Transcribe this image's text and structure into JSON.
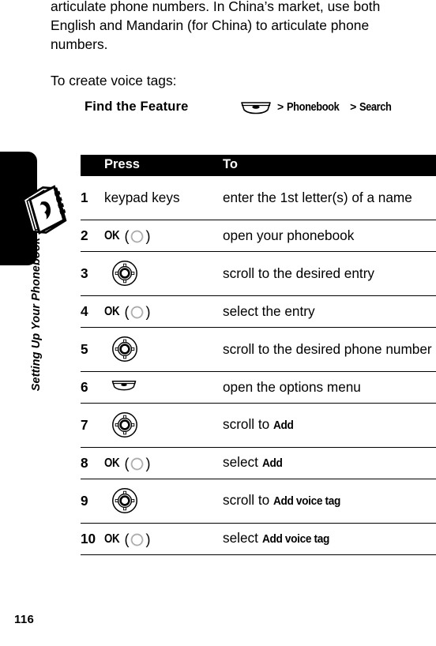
{
  "sidebar": {
    "chapter_title": "Setting Up Your Phonebook",
    "icon": "phonebook-icon"
  },
  "page": {
    "number": "116"
  },
  "intro": {
    "paragraph_1": "articulate phone numbers. In China’s market, use both English and Mandarin (for China) to articulate phone numbers.",
    "paragraph_2": "To create voice tags:"
  },
  "find_the_feature": {
    "label": "Find the Feature",
    "key_icon": "menu-key-icon",
    "path": [
      {
        "separator": ">",
        "item": "Phonebook"
      },
      {
        "separator": ">",
        "item": "Search"
      }
    ]
  },
  "steps_table": {
    "headers": {
      "number": "",
      "press": "Press",
      "to": "To"
    },
    "rows": [
      {
        "number": "1",
        "press_kind": "text",
        "press_text": "keypad keys",
        "to_prefix": "enter the 1st letter(s) of a name",
        "to_bold": ""
      },
      {
        "number": "2",
        "press_kind": "ok",
        "press_text": "OK",
        "to_prefix": "open your phonebook",
        "to_bold": ""
      },
      {
        "number": "3",
        "press_kind": "wheel",
        "press_text": "",
        "to_prefix": "scroll to the desired entry",
        "to_bold": ""
      },
      {
        "number": "4",
        "press_kind": "ok",
        "press_text": "OK",
        "to_prefix": "select the entry",
        "to_bold": ""
      },
      {
        "number": "5",
        "press_kind": "wheel",
        "press_text": "",
        "to_prefix": "scroll to the desired phone number",
        "to_bold": ""
      },
      {
        "number": "6",
        "press_kind": "menu",
        "press_text": "",
        "to_prefix": "open the options menu",
        "to_bold": ""
      },
      {
        "number": "7",
        "press_kind": "wheel",
        "press_text": "",
        "to_prefix": "scroll to ",
        "to_bold": "Add"
      },
      {
        "number": "8",
        "press_kind": "ok",
        "press_text": "OK",
        "to_prefix": "select ",
        "to_bold": "Add"
      },
      {
        "number": "9",
        "press_kind": "wheel",
        "press_text": "",
        "to_prefix": "scroll to ",
        "to_bold": "Add voice tag"
      },
      {
        "number": "10",
        "press_kind": "ok",
        "press_text": "OK",
        "to_prefix": "select ",
        "to_bold": "Add voice tag"
      }
    ]
  },
  "colors": {
    "ink": "#000000",
    "paper": "#ffffff"
  }
}
